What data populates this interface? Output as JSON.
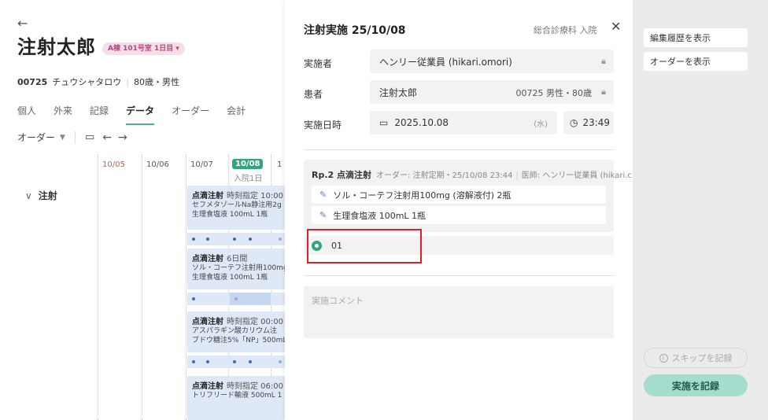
{
  "left": {
    "patient_name": "注射太郎",
    "ward_badge": "A棟 101号室 1日目",
    "patient_id": "00725",
    "patient_kana": "チュウシャタロウ",
    "patient_age_sex": "80歳・男性",
    "tabs": [
      "個人",
      "外来",
      "記録",
      "データ",
      "オーダー",
      "会計"
    ],
    "active_tab": "データ",
    "order_filter": "オーダー",
    "timeline": {
      "days": [
        "10/05",
        "10/06",
        "10/07",
        "10/08",
        "1"
      ],
      "today": "10/08",
      "today_sub": "入院1日",
      "category": "注射"
    },
    "orders": [
      {
        "title": "点滴注射",
        "sub": "時刻指定 10:00",
        "line1": "セフメタゾールNa静注用2g",
        "line2": "生理食塩液 100mL 1瓶"
      },
      {
        "title": "点滴注射",
        "sub": "6日間",
        "line1": "ソル・コーテフ注射用100mg",
        "line2": "生理食塩液 100mL 1瓶"
      },
      {
        "title": "点滴注射",
        "sub": "時刻指定 00:00",
        "line1": "アスパラギン酸カリウム注",
        "line2": "ブドウ糖注5%「NP」500mL"
      },
      {
        "title": "点滴注射",
        "sub": "時刻指定 06:00",
        "line1": "トリフリード輸液 500mL 1",
        "line2": ""
      }
    ]
  },
  "middle": {
    "title": "注射実施 25/10/08",
    "dept": "総合診療科 入院",
    "fields": {
      "executor_label": "実施者",
      "executor_value": "ヘンリー従業員 (hikari.omori)",
      "patient_label": "患者",
      "patient_value": "注射太郎",
      "patient_meta": "00725 男性・80歳",
      "date_label": "実施日時",
      "date_value": "2025.10.08",
      "weekday": "(水)",
      "time_value": "23:49"
    },
    "rx": {
      "rp": "Rp.2 点滴注射",
      "order_info": "オーダー: 注射定期・25/10/08 23:44",
      "doctor": "医師: ヘンリー従業員 (hikari.c",
      "items": [
        "ソル・コーテフ注射用100mg (溶解液付) 2瓶",
        "生理食塩液 100mL 1瓶"
      ]
    },
    "lot_value": "01",
    "comment_placeholder": "実施コメント"
  },
  "right": {
    "show_history": "編集履歴を表示",
    "show_order": "オーダーを表示",
    "skip": "スキップを記録",
    "submit": "実施を記録"
  },
  "colors": {
    "accent": "#33a57e",
    "order_card": "#dfe8f7",
    "highlight": "#e01e24"
  }
}
